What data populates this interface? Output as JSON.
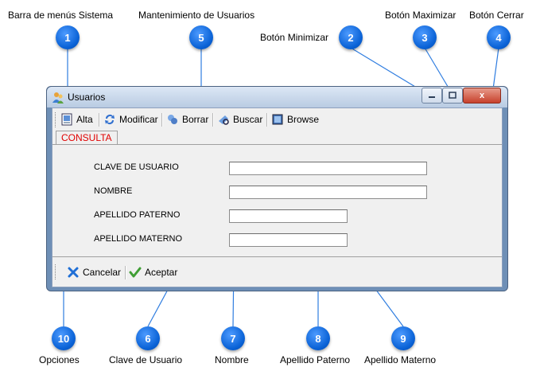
{
  "annotations": {
    "callouts": [
      {
        "number": "1",
        "label": "Barra de menús Sistema"
      },
      {
        "number": "2",
        "label": "Botón Minimizar"
      },
      {
        "number": "3",
        "label": "Botón Maximizar"
      },
      {
        "number": "4",
        "label": "Botón Cerrar"
      },
      {
        "number": "5",
        "label": "Mantenimiento de Usuarios"
      },
      {
        "number": "6",
        "label": "Clave de Usuario"
      },
      {
        "number": "7",
        "label": "Nombre"
      },
      {
        "number": "8",
        "label": "Apellido Paterno"
      },
      {
        "number": "9",
        "label": "Apellido Materno"
      },
      {
        "number": "10",
        "label": "Opciones"
      }
    ],
    "marker_color": "#0a62d6"
  },
  "window": {
    "title": "Usuarios",
    "icon": "users-icon",
    "minimize_icon": "minimize-icon",
    "maximize_icon": "maximize-icon",
    "close_icon": "close-icon",
    "close_glyph": "x"
  },
  "toolbar": {
    "items": [
      {
        "label": "Alta",
        "icon": "new-record-icon"
      },
      {
        "label": "Modificar",
        "icon": "refresh-icon"
      },
      {
        "label": "Borrar",
        "icon": "delete-icon"
      },
      {
        "label": "Buscar",
        "icon": "search-icon"
      },
      {
        "label": "Browse",
        "icon": "browse-icon"
      }
    ]
  },
  "tab": {
    "label": "CONSULTA",
    "color": "#e00000"
  },
  "form": {
    "fields": [
      {
        "label": "CLAVE DE USUARIO",
        "value": ""
      },
      {
        "label": "NOMBRE",
        "value": ""
      },
      {
        "label": "APELLIDO PATERNO",
        "value": ""
      },
      {
        "label": "APELLIDO MATERNO",
        "value": ""
      }
    ]
  },
  "actions": {
    "cancel_label": "Cancelar",
    "cancel_icon": "cancel-x-icon",
    "accept_label": "Aceptar",
    "accept_icon": "checkmark-icon"
  }
}
